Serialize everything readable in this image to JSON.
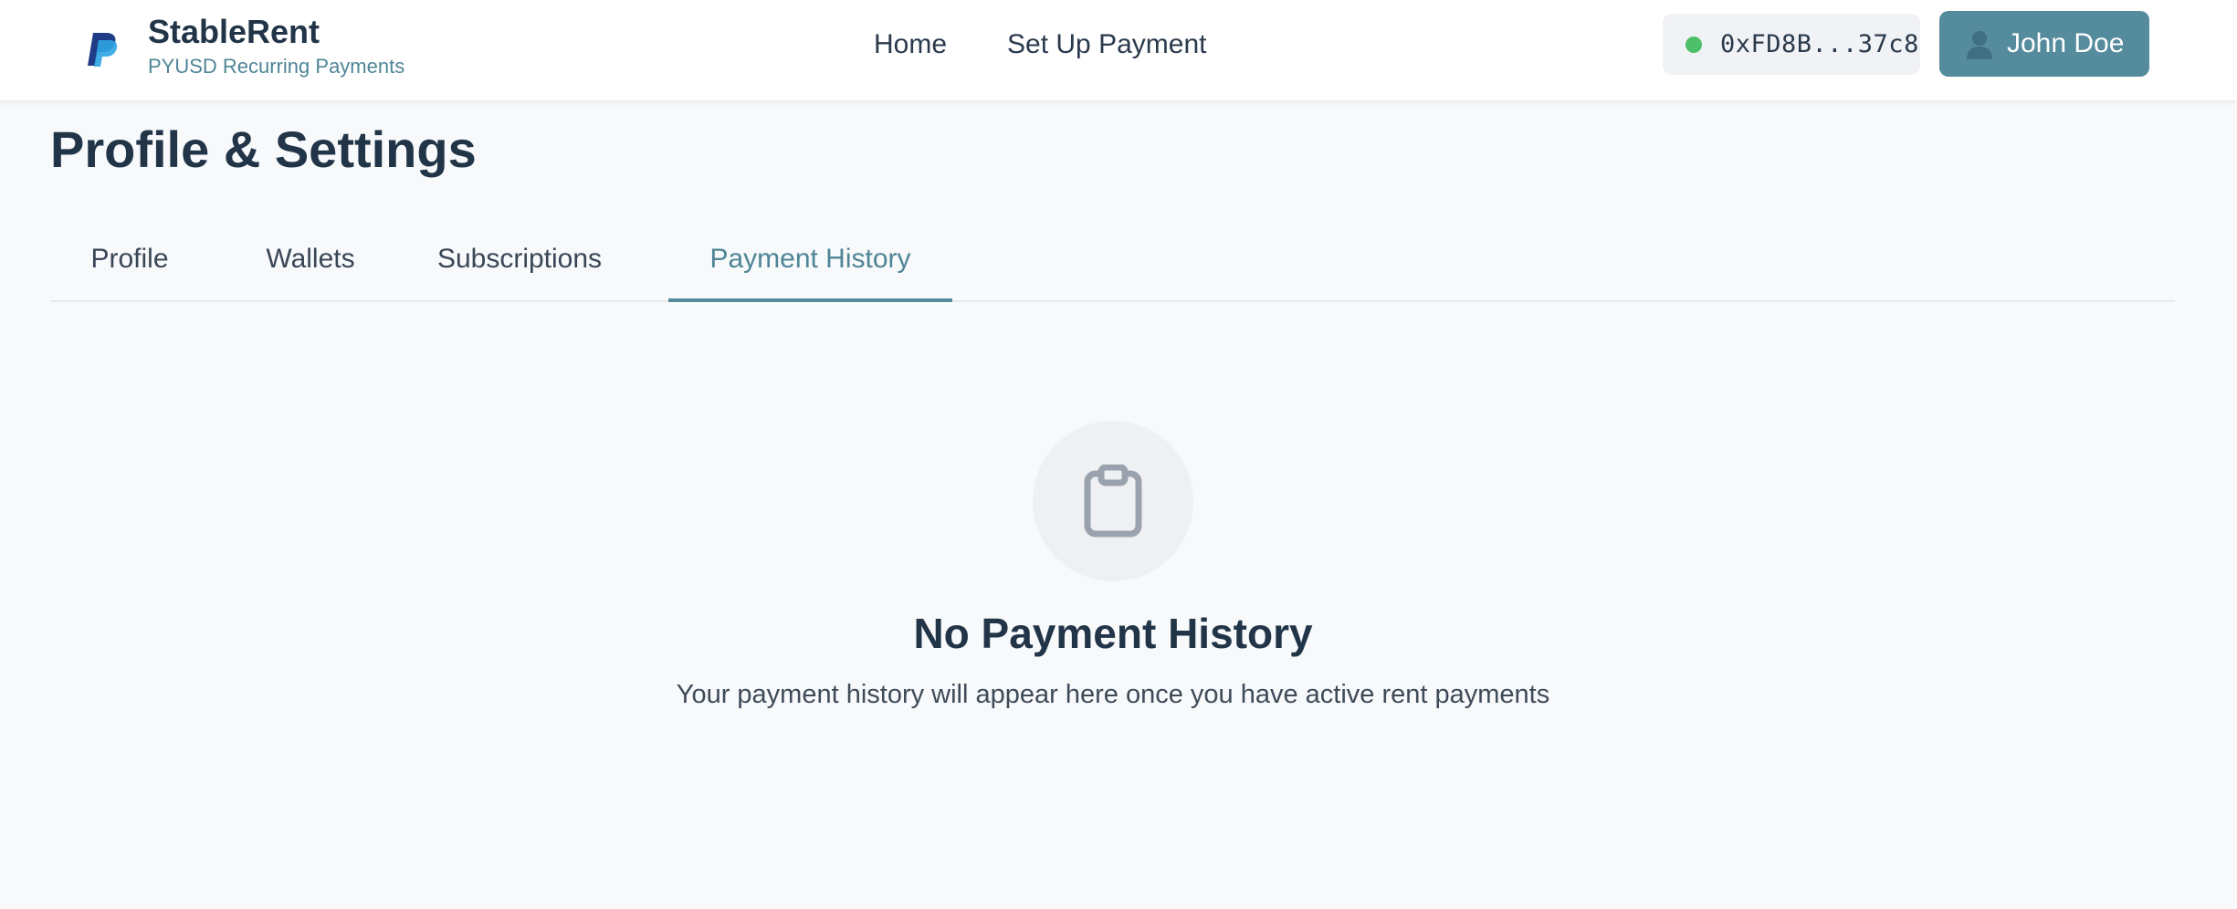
{
  "header": {
    "brand_name": "StableRent",
    "brand_tagline": "PYUSD Recurring Payments",
    "nav": [
      {
        "label": "Home"
      },
      {
        "label": "Set Up Payment"
      }
    ],
    "wallet": {
      "address": "0xFD8B...37c8",
      "status_color": "#4cbf68"
    },
    "user": {
      "name": "John Doe",
      "icon": "user-icon"
    }
  },
  "page": {
    "title": "Profile & Settings",
    "tabs": [
      {
        "label": "Profile",
        "active": false
      },
      {
        "label": "Wallets",
        "active": false
      },
      {
        "label": "Subscriptions",
        "active": false
      },
      {
        "label": "Payment History",
        "active": true
      }
    ]
  },
  "empty_state": {
    "icon": "clipboard-icon",
    "title": "No Payment History",
    "description": "Your payment history will appear here once you have active rent payments"
  },
  "colors": {
    "accent": "#548b9d",
    "accent_text": "#4f8596",
    "title": "#223548",
    "background": "#f7f9fb"
  }
}
